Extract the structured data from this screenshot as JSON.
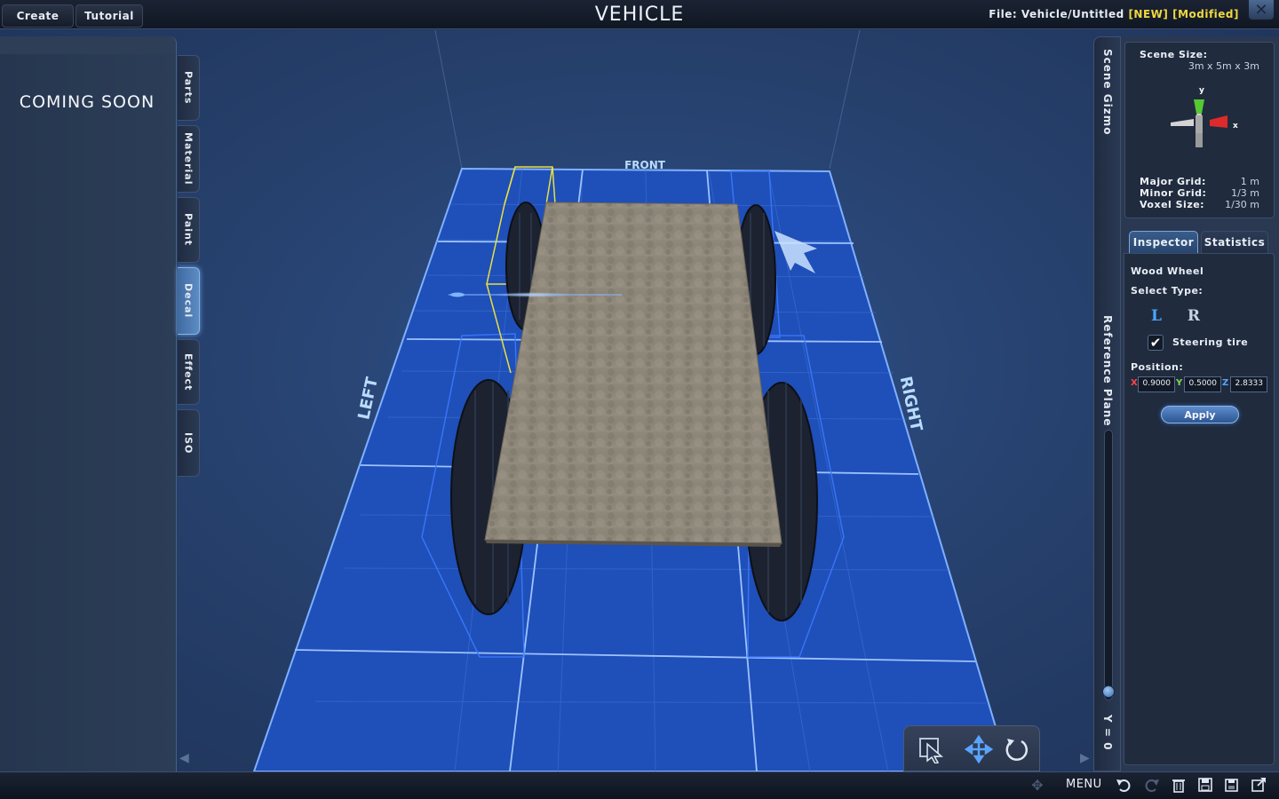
{
  "topbar": {
    "create_label": "Create",
    "tutorial_label": "Tutorial",
    "title": "VEHICLE",
    "file_label": "File:",
    "file_path": "Vehicle/Untitled",
    "tag_new": "[NEW]",
    "tag_modified": "[Modified]",
    "close_icon": "close-icon"
  },
  "left_panel": {
    "coming_soon": "COMING SOON",
    "tabs": [
      {
        "label": "Parts",
        "active": false
      },
      {
        "label": "Material",
        "active": false
      },
      {
        "label": "Paint",
        "active": false
      },
      {
        "label": "Decal",
        "active": true
      },
      {
        "label": "Effect",
        "active": false
      },
      {
        "label": "ISO",
        "active": false
      }
    ]
  },
  "scene": {
    "label_front": "FRONT",
    "label_left": "LEFT",
    "label_right": "RIGHT",
    "colors": {
      "grid_fill": "#1f4fb8",
      "grid_line": "#4f84e6",
      "deck": "#8e8678",
      "wheel": "#1c2230",
      "selection_yellow": "#e8e040",
      "selection_blue": "#3a78ff"
    }
  },
  "right_panel": {
    "scene_gizmo_label": "Scene Gizmo",
    "reference_plane_label": "Reference Plane",
    "reference_value": "Y = 0",
    "scene_size_label": "Scene Size:",
    "scene_size_value": "3m x 5m x 3m",
    "axis_y": "y",
    "axis_x": "x",
    "major_grid_label": "Major Grid:",
    "major_grid_value": "1 m",
    "minor_grid_label": "Minor Grid:",
    "minor_grid_value": "1/3 m",
    "voxel_size_label": "Voxel Size:",
    "voxel_size_value": "1/30 m",
    "tab_inspector": "Inspector",
    "tab_statistics": "Statistics",
    "part_name": "Wood Wheel",
    "select_type_label": "Select Type:",
    "type_left": "L",
    "type_right": "R",
    "steering_label": "Steering tire",
    "steering_checked": true,
    "position_label": "Position:",
    "pos_x_label": "X",
    "pos_x": "0.9000",
    "pos_y_label": "Y",
    "pos_y": "0.5000",
    "pos_z_label": "Z",
    "pos_z": "2.8333",
    "apply_label": "Apply"
  },
  "bottombar": {
    "menu_label": "MENU"
  }
}
